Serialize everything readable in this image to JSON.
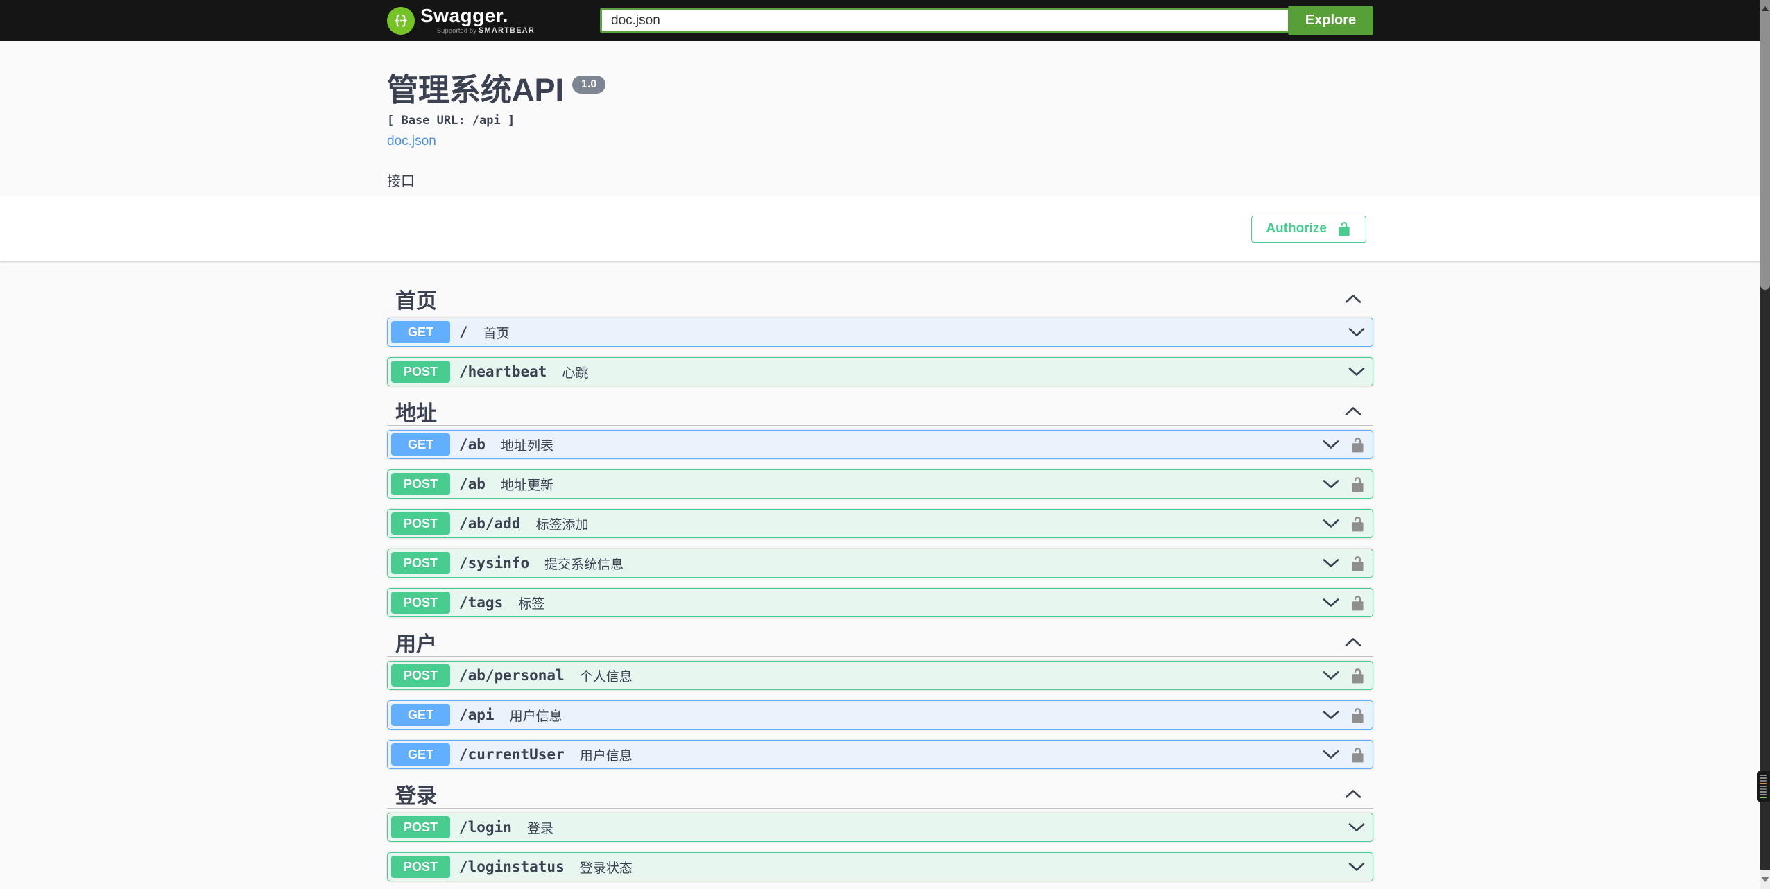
{
  "topbar": {
    "brand": "Swagger.",
    "tagline_prefix": "Supported by",
    "tagline_brand": "SMARTBEAR",
    "search_value": "doc.json",
    "explore_label": "Explore"
  },
  "info": {
    "title": "管理系统API",
    "version": "1.0",
    "base_url_label": "[ Base URL: /api ]",
    "spec_link": "doc.json",
    "description": "接口"
  },
  "auth": {
    "authorize_label": "Authorize"
  },
  "method_colors": {
    "GET": {
      "badge": "#61affe",
      "border": "#61affe",
      "bg": "#eaf2fb"
    },
    "POST": {
      "badge": "#49cc90",
      "border": "#49cc90",
      "bg": "#e8f6f0"
    }
  },
  "accent_colors": {
    "authorize_green": "#49cc90",
    "explore_green": "#57a037",
    "link_blue": "#4990e2",
    "text_dark": "#3b4151",
    "lock_gray": "#8f8f8f"
  },
  "sections": [
    {
      "title": "首页",
      "expanded": true,
      "rows": [
        {
          "method": "GET",
          "path": "/",
          "desc": "首页",
          "locked": false
        },
        {
          "method": "POST",
          "path": "/heartbeat",
          "desc": "心跳",
          "locked": false
        }
      ]
    },
    {
      "title": "地址",
      "expanded": true,
      "rows": [
        {
          "method": "GET",
          "path": "/ab",
          "desc": "地址列表",
          "locked": true
        },
        {
          "method": "POST",
          "path": "/ab",
          "desc": "地址更新",
          "locked": true
        },
        {
          "method": "POST",
          "path": "/ab/add",
          "desc": "标签添加",
          "locked": true
        },
        {
          "method": "POST",
          "path": "/sysinfo",
          "desc": "提交系统信息",
          "locked": true
        },
        {
          "method": "POST",
          "path": "/tags",
          "desc": "标签",
          "locked": true
        }
      ]
    },
    {
      "title": "用户",
      "expanded": true,
      "rows": [
        {
          "method": "POST",
          "path": "/ab/personal",
          "desc": "个人信息",
          "locked": true
        },
        {
          "method": "GET",
          "path": "/api",
          "desc": "用户信息",
          "locked": true
        },
        {
          "method": "GET",
          "path": "/currentUser",
          "desc": "用户信息",
          "locked": true
        }
      ]
    },
    {
      "title": "登录",
      "expanded": true,
      "rows": [
        {
          "method": "POST",
          "path": "/login",
          "desc": "登录",
          "locked": false
        },
        {
          "method": "POST",
          "path": "/loginstatus",
          "desc": "登录状态",
          "locked": false
        }
      ]
    }
  ],
  "scrollbar": {
    "marker_line_colors": [
      "#8a8a8a",
      "#8a8a8a",
      "#7a7a7a",
      "#d7903c",
      "#8a8a8a",
      "#6e6e6e",
      "#8a8a8a",
      "#989898",
      "#8ac765"
    ]
  }
}
